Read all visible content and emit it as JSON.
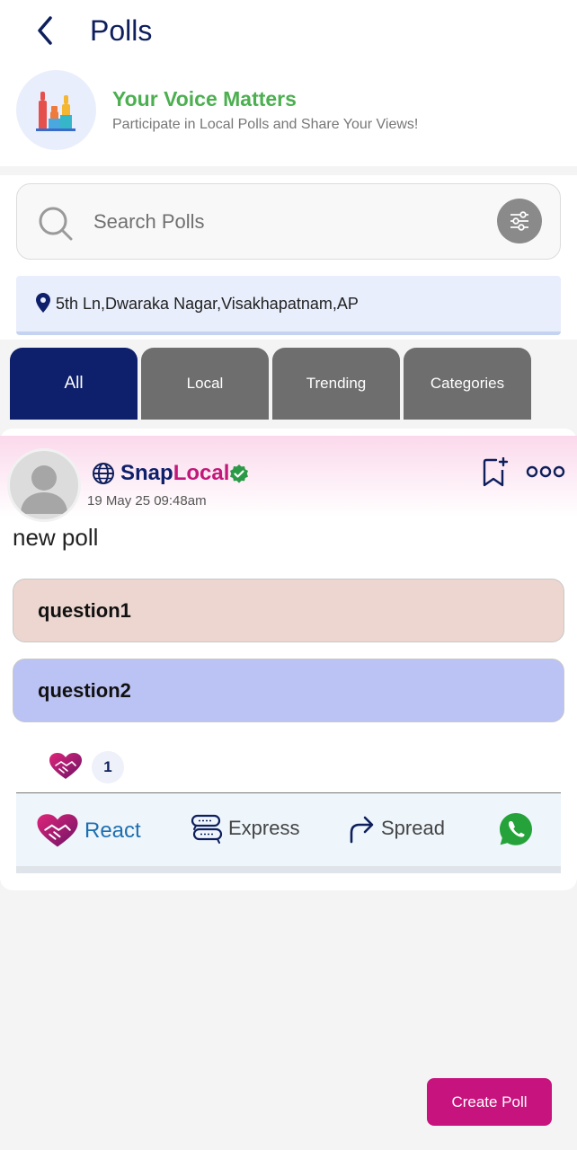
{
  "header": {
    "title": "Polls",
    "banner_title": "Your Voice Matters",
    "banner_subtitle": "Participate in Local Polls and Share Your Views!"
  },
  "search": {
    "placeholder": "Search Polls"
  },
  "location": {
    "text": "5th Ln,Dwaraka Nagar,Visakhapatnam,AP"
  },
  "tabs": [
    {
      "label": "All",
      "active": true
    },
    {
      "label": "Local",
      "active": false
    },
    {
      "label": "Trending",
      "active": false
    },
    {
      "label": "Categories",
      "active": false
    }
  ],
  "post": {
    "author_part1": "Snap",
    "author_part2": "Local",
    "time": "19 May 25 09:48am",
    "text": "new poll",
    "options": [
      {
        "label": "question1"
      },
      {
        "label": "question2"
      }
    ],
    "reaction_count": "1"
  },
  "actions": {
    "react": "React",
    "express": "Express",
    "spread": "Spread"
  },
  "create_button": "Create Poll",
  "colors": {
    "brand_navy": "#0e1f6b",
    "brand_magenta": "#c7137d",
    "success_green": "#4caf50"
  }
}
